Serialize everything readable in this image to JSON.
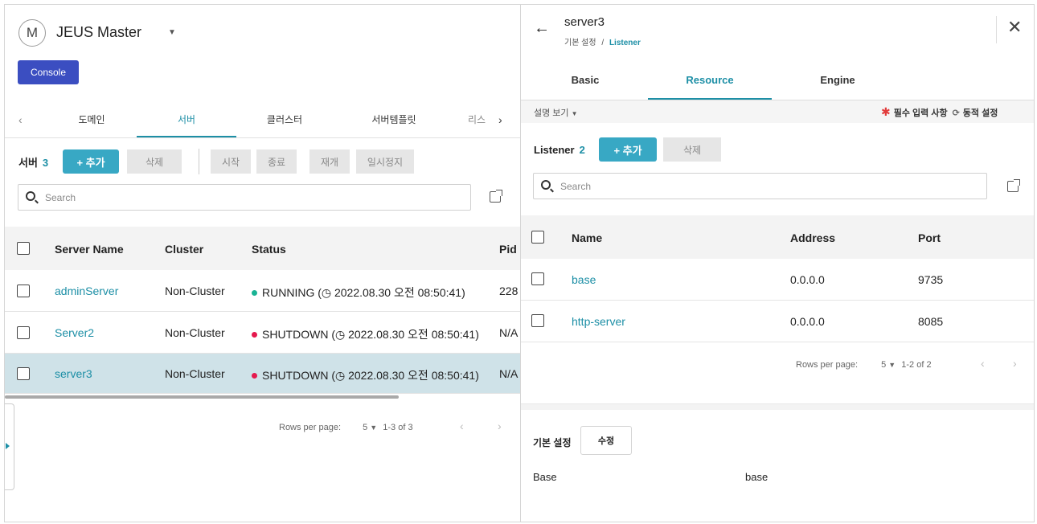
{
  "app": {
    "avatar_letter": "M",
    "title": "JEUS Master",
    "console_label": "Console"
  },
  "left_tabs": {
    "items": [
      "도메인",
      "서버",
      "클러스터",
      "서버템플릿",
      "리스"
    ],
    "active": "서버"
  },
  "servers": {
    "label": "서버",
    "count": "3",
    "add_label": "+ 추가",
    "delete_label": "삭제",
    "start_label": "시작",
    "stop_label": "종료",
    "restart_label": "재개",
    "suspend_label": "일시정지",
    "search_placeholder": "Search",
    "columns": [
      "Server Name",
      "Cluster",
      "Status",
      "Pid"
    ],
    "rows": [
      {
        "name": "adminServer",
        "cluster": "Non-Cluster",
        "status": "RUNNING (◷ 2022.08.30 오전 08:50:41)",
        "status_color": "#19b394",
        "pid": "228"
      },
      {
        "name": "Server2",
        "cluster": "Non-Cluster",
        "status": "SHUTDOWN (◷ 2022.08.30 오전 08:50:41)",
        "status_color": "#e5194e",
        "pid": "N/A"
      },
      {
        "name": "server3",
        "cluster": "Non-Cluster",
        "status": "SHUTDOWN (◷ 2022.08.30 오전 08:50:41)",
        "status_color": "#e5194e",
        "pid": "N/A"
      }
    ],
    "pager": {
      "rows_per_page_label": "Rows per page:",
      "rows_per_page": "5",
      "range": "1-3 of 3"
    }
  },
  "detail": {
    "title": "server3",
    "breadcrumb_parent": "기본 설정",
    "breadcrumb_sep": "/",
    "breadcrumb_current": "Listener",
    "tabs": [
      "Basic",
      "Resource",
      "Engine"
    ],
    "active_tab": "Resource",
    "desc_toggle": "설명 보기",
    "required_note": "필수 입력 사항",
    "dynamic_note": "동적 설정",
    "listener_label": "Listener",
    "listener_count": "2",
    "add_label": "+ 추가",
    "delete_label": "삭제",
    "search_placeholder": "Search",
    "columns": [
      "Name",
      "Address",
      "Port"
    ],
    "rows": [
      {
        "name": "base",
        "address": "0.0.0.0",
        "port": "9735"
      },
      {
        "name": "http-server",
        "address": "0.0.0.0",
        "port": "8085"
      }
    ],
    "pager": {
      "rows_per_page_label": "Rows per page:",
      "rows_per_page": "5",
      "range": "1-2 of 2"
    },
    "basic_section": {
      "title": "기본 설정",
      "edit_label": "수정",
      "key": "Base",
      "value": "base"
    }
  },
  "colors": {
    "accent": "#1d8fa6",
    "console": "#3b4ec1",
    "add_button": "#38a8c4",
    "selected_row": "#cfe2e8"
  }
}
